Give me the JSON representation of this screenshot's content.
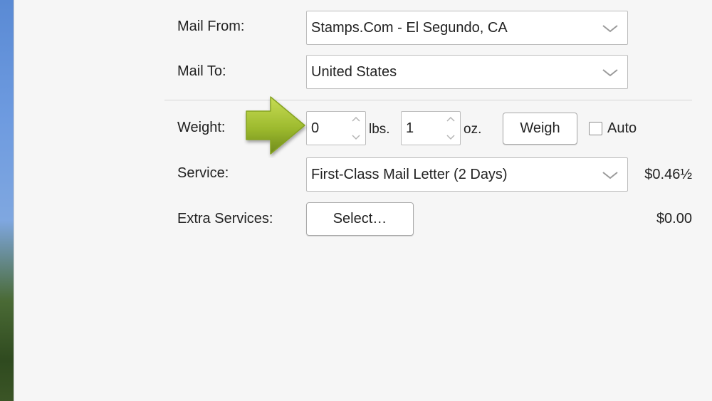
{
  "mail_from": {
    "label": "Mail From:",
    "value": "Stamps.Com - El Segundo, CA"
  },
  "mail_to": {
    "label": "Mail To:",
    "value": "United States"
  },
  "weight": {
    "label": "Weight:",
    "lbs_value": "0",
    "lbs_unit": "lbs.",
    "oz_value": "1",
    "oz_unit": "oz.",
    "weigh_button": "Weigh",
    "auto_label": "Auto",
    "auto_checked": false
  },
  "service": {
    "label": "Service:",
    "value": "First-Class Mail Letter (2 Days)",
    "price": "$0.46½"
  },
  "extra_services": {
    "label": "Extra Services:",
    "button": "Select…",
    "price": "$0.00"
  },
  "colors": {
    "callout_arrow": "#8fb02a"
  }
}
